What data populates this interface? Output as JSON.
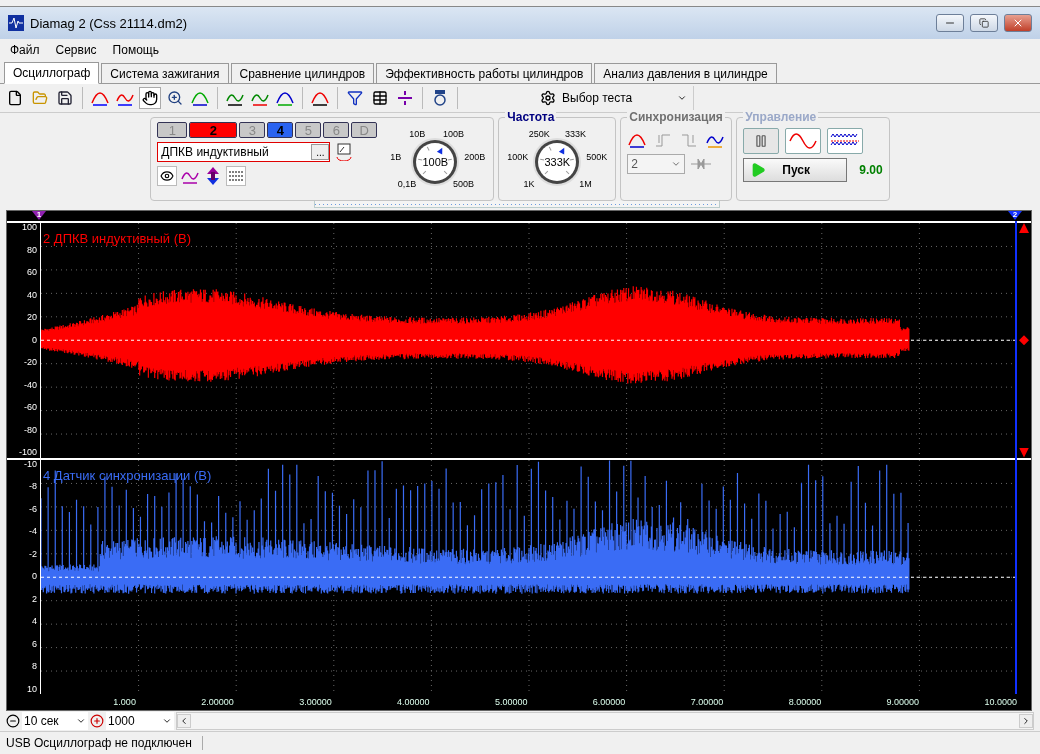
{
  "window": {
    "title": "Diamag 2 (Css 21114.dm2)"
  },
  "menu": [
    "Файл",
    "Сервис",
    "Помощь"
  ],
  "tabs": [
    {
      "label": "Осциллограф",
      "selected": true
    },
    {
      "label": "Система зажигания",
      "selected": false
    },
    {
      "label": "Сравнение цилиндров",
      "selected": false
    },
    {
      "label": "Эффективность работы цилиндров",
      "selected": false
    },
    {
      "label": "Анализ давления в цилиндре",
      "selected": false
    }
  ],
  "toolbar": {
    "test_selector": "Выбор теста"
  },
  "channel_panel": {
    "channels": [
      {
        "label": "1",
        "on": false,
        "color": "#c8c8c8"
      },
      {
        "label": "2",
        "on": true,
        "color": "#ff0000"
      },
      {
        "label": "3",
        "on": false,
        "color": "#c8c8c8"
      },
      {
        "label": "4",
        "on": true,
        "color": "#2a63f0"
      },
      {
        "label": "5",
        "on": false,
        "color": "#c8c8c8"
      },
      {
        "label": "6",
        "on": false,
        "color": "#c8c8c8"
      },
      {
        "label": "D",
        "on": false,
        "color": "#c8c8c8"
      }
    ],
    "sensor": "ДПКВ индуктивный",
    "browse": "...",
    "scale": {
      "labels": [
        {
          "text": "0,1В",
          "selected": false
        },
        {
          "text": "1В",
          "selected": false
        },
        {
          "text": "10В",
          "selected": false
        },
        {
          "text": "100В",
          "selected": true
        },
        {
          "text": "200В",
          "selected": false
        },
        {
          "text": "500В",
          "selected": false
        }
      ],
      "value": "100В"
    }
  },
  "frequency": {
    "title": "Частота",
    "labels": [
      {
        "text": "1K",
        "selected": false
      },
      {
        "text": "100K",
        "selected": false
      },
      {
        "text": "250K",
        "selected": false
      },
      {
        "text": "333K",
        "selected": true
      },
      {
        "text": "500K",
        "selected": false
      },
      {
        "text": "1M",
        "selected": false
      }
    ],
    "value": "333K"
  },
  "sync": {
    "title": "Синхронизация",
    "channel": "2"
  },
  "control": {
    "title": "Управление",
    "disabled": true,
    "start": "Пуск",
    "reading": "9.00"
  },
  "markers": [
    "1",
    "2"
  ],
  "traces": [
    {
      "label": "2 ДПКВ индуктивный (В)",
      "color": "#ff0000",
      "yticks": [
        "100",
        "80",
        "60",
        "40",
        "20",
        "0",
        "-20",
        "-40",
        "-60",
        "-80",
        "-100"
      ]
    },
    {
      "label": "4 Датчик синхронизации (В)",
      "color": "#3a6cf5",
      "yticks": [
        "-10",
        "-8",
        "-6",
        "-4",
        "-2",
        "0",
        "2",
        "4",
        "6",
        "8",
        "10"
      ]
    }
  ],
  "xticks": [
    "1.000",
    "2.00000",
    "3.00000",
    "4.00000",
    "5.00000",
    "6.00000",
    "7.00000",
    "8.00000",
    "9.00000",
    "10.0000"
  ],
  "bottom": {
    "duration": "10 сек",
    "points": "1000"
  },
  "status_bar": "USB Осциллограф не подключен"
}
